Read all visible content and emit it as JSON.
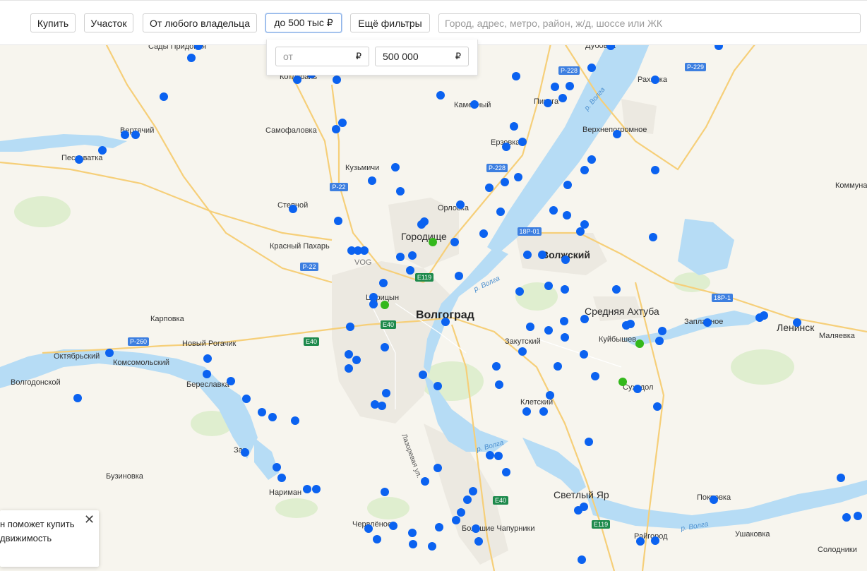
{
  "filters": {
    "deal": "Купить",
    "type": "Участок",
    "owner": "От любого владельца",
    "price": "до 500 тыс ₽",
    "more": "Ещё фильтры"
  },
  "search": {
    "placeholder": "Город, адрес, метро, район, ж/д, шоссе или ЖК"
  },
  "price_dropdown": {
    "from_placeholder": "от",
    "from_currency": "₽",
    "to_value": "500 000",
    "to_currency": "₽"
  },
  "promo": {
    "text": "н поможет купить\nдвижимость",
    "close": "✕"
  },
  "colors": {
    "pin_blue": "#0b62f0",
    "pin_green": "#34b81c",
    "water": "#b6dcf5",
    "road": "#f6cf79",
    "city": "#ece9e1"
  },
  "map": {
    "cities": [
      "Волгоград",
      "Городище",
      "Волжский",
      "Средняя Ахтуба",
      "Ленинск",
      "Светлый Яр"
    ],
    "places": [
      "Сады Придонья",
      "Котлубань",
      "Вертячий",
      "Песковатка",
      "Самофаловка",
      "Кузьмичи",
      "Степной",
      "Красный Пахарь",
      "VOG",
      "Царицын",
      "Карповка",
      "Новый Рогачик",
      "Октябрьский",
      "Комсомольский",
      "Волгодонской",
      "Береславка",
      "Зап",
      "Бузиновка",
      "Нариман",
      "Червлёное",
      "Большие Чапурники",
      "Орловка",
      "Каменный",
      "Ерзовка",
      "Пичуга",
      "Дубовка",
      "Рахинка",
      "Верхнепогромное",
      "Заплавное",
      "Маляевка",
      "Коммуна",
      "Закутский",
      "Куйбышев",
      "Суходол",
      "Клетский",
      "Покровка",
      "Райгород",
      "Ушаковка",
      "Солодники"
    ],
    "shields": [
      "Р-228",
      "Р-229",
      "Р-22",
      "Р-22",
      "Р-260",
      "18Р-01",
      "18Р-1",
      "E119",
      "E40",
      "E40",
      "E40",
      "E119"
    ],
    "rivers": [
      "р. Волга",
      "р. Волга",
      "р. Волга",
      "р. Волга"
    ],
    "street": "Лазоревая ул."
  }
}
